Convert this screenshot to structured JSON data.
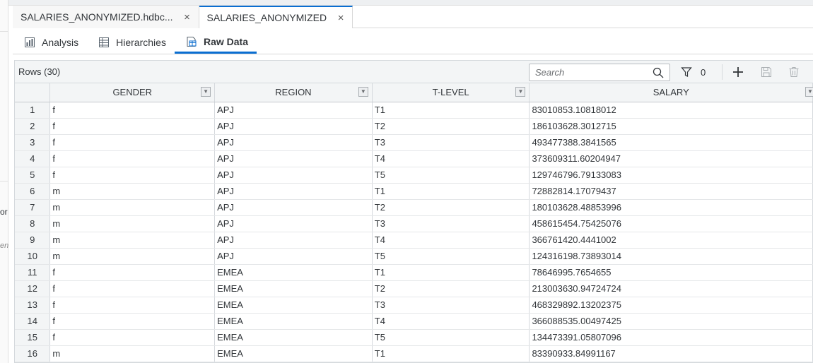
{
  "left_panel": {
    "fragment_1": "or",
    "fragment_2": "ent"
  },
  "editor_tabs": [
    {
      "label": "SALARIES_ANONYMIZED.hdbc...",
      "close": "×",
      "active": false
    },
    {
      "label": "SALARIES_ANONYMIZED",
      "close": "×",
      "active": true
    }
  ],
  "view_tabs": [
    {
      "label": "Analysis",
      "icon": "analysis-chart-icon",
      "active": false
    },
    {
      "label": "Hierarchies",
      "icon": "hierarchy-table-icon",
      "active": false
    },
    {
      "label": "Raw Data",
      "icon": "raw-data-table-icon",
      "active": true
    }
  ],
  "toolbar": {
    "rows_label": "Rows (30)",
    "search_placeholder": "Search",
    "filter_count": "0",
    "icons": [
      "search-icon",
      "filter-icon",
      "add-icon",
      "save-icon",
      "delete-icon"
    ]
  },
  "table": {
    "columns": [
      "GENDER",
      "REGION",
      "T-LEVEL",
      "SALARY"
    ],
    "rows": [
      [
        "1",
        "f",
        "APJ",
        "T1",
        "83010853.10818012"
      ],
      [
        "2",
        "f",
        "APJ",
        "T2",
        "186103628.3012715"
      ],
      [
        "3",
        "f",
        "APJ",
        "T3",
        "493477388.3841565"
      ],
      [
        "4",
        "f",
        "APJ",
        "T4",
        "373609311.60204947"
      ],
      [
        "5",
        "f",
        "APJ",
        "T5",
        "129746796.79133083"
      ],
      [
        "6",
        "m",
        "APJ",
        "T1",
        "72882814.17079437"
      ],
      [
        "7",
        "m",
        "APJ",
        "T2",
        "180103628.48853996"
      ],
      [
        "8",
        "m",
        "APJ",
        "T3",
        "458615454.75425076"
      ],
      [
        "9",
        "m",
        "APJ",
        "T4",
        "366761420.4441002"
      ],
      [
        "10",
        "m",
        "APJ",
        "T5",
        "124316198.73893014"
      ],
      [
        "11",
        "f",
        "EMEA",
        "T1",
        "78646995.7654655"
      ],
      [
        "12",
        "f",
        "EMEA",
        "T2",
        "213003630.94724724"
      ],
      [
        "13",
        "f",
        "EMEA",
        "T3",
        "468329892.13202375"
      ],
      [
        "14",
        "f",
        "EMEA",
        "T4",
        "366088535.00497425"
      ],
      [
        "15",
        "f",
        "EMEA",
        "T5",
        "134473391.05807096"
      ],
      [
        "16",
        "m",
        "EMEA",
        "T1",
        "83390933.84991167"
      ]
    ]
  },
  "colors": {
    "accent": "#0a6ed1",
    "header_bg": "#f3f5f6",
    "border": "#d5d9dd"
  }
}
